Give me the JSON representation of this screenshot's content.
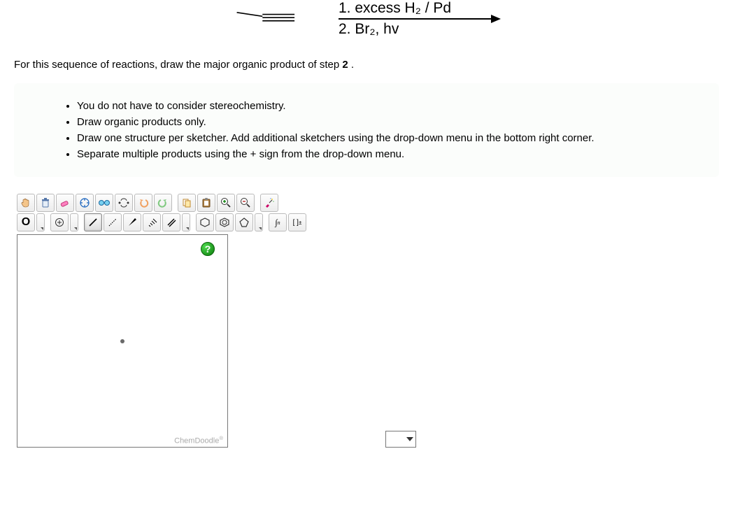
{
  "reaction": {
    "step1": "1. excess H₂ / Pd",
    "step2": "2. Br₂, hv"
  },
  "prompt_prefix": "For this sequence of reactions, draw the major organic product of step ",
  "prompt_step": "2",
  "prompt_suffix": " .",
  "instructions": [
    "You do not have to consider stereochemistry.",
    "Draw organic products only.",
    "Draw one structure per sketcher. Add additional sketchers using the drop-down menu in the bottom right corner.",
    "Separate multiple products using the + sign from the drop-down menu."
  ],
  "toolbar1": {
    "hand": "✋",
    "clear": "🗑",
    "erase": "橡",
    "center": "✥",
    "glasses": "👓",
    "split": "⇋",
    "undo": "↶",
    "redo": "↷",
    "copy": "⧉",
    "paste": "📋",
    "zoom_in": "+",
    "zoom_out": "−",
    "clean": "✨"
  },
  "toolbar2": {
    "element_label": "O",
    "plus": "⊕",
    "single_bond": "/",
    "dotted_bond": "⋰",
    "wedge_bold": "▮",
    "wedge_hash": "▨",
    "double": "═",
    "ring6": "⬡",
    "ring_benzene": "⌬",
    "ring5": "⬠",
    "integral": "∫n",
    "brackets": "[ ]±"
  },
  "canvas": {
    "help": "?",
    "brand": "ChemDoodle",
    "brand_sup": "®"
  }
}
